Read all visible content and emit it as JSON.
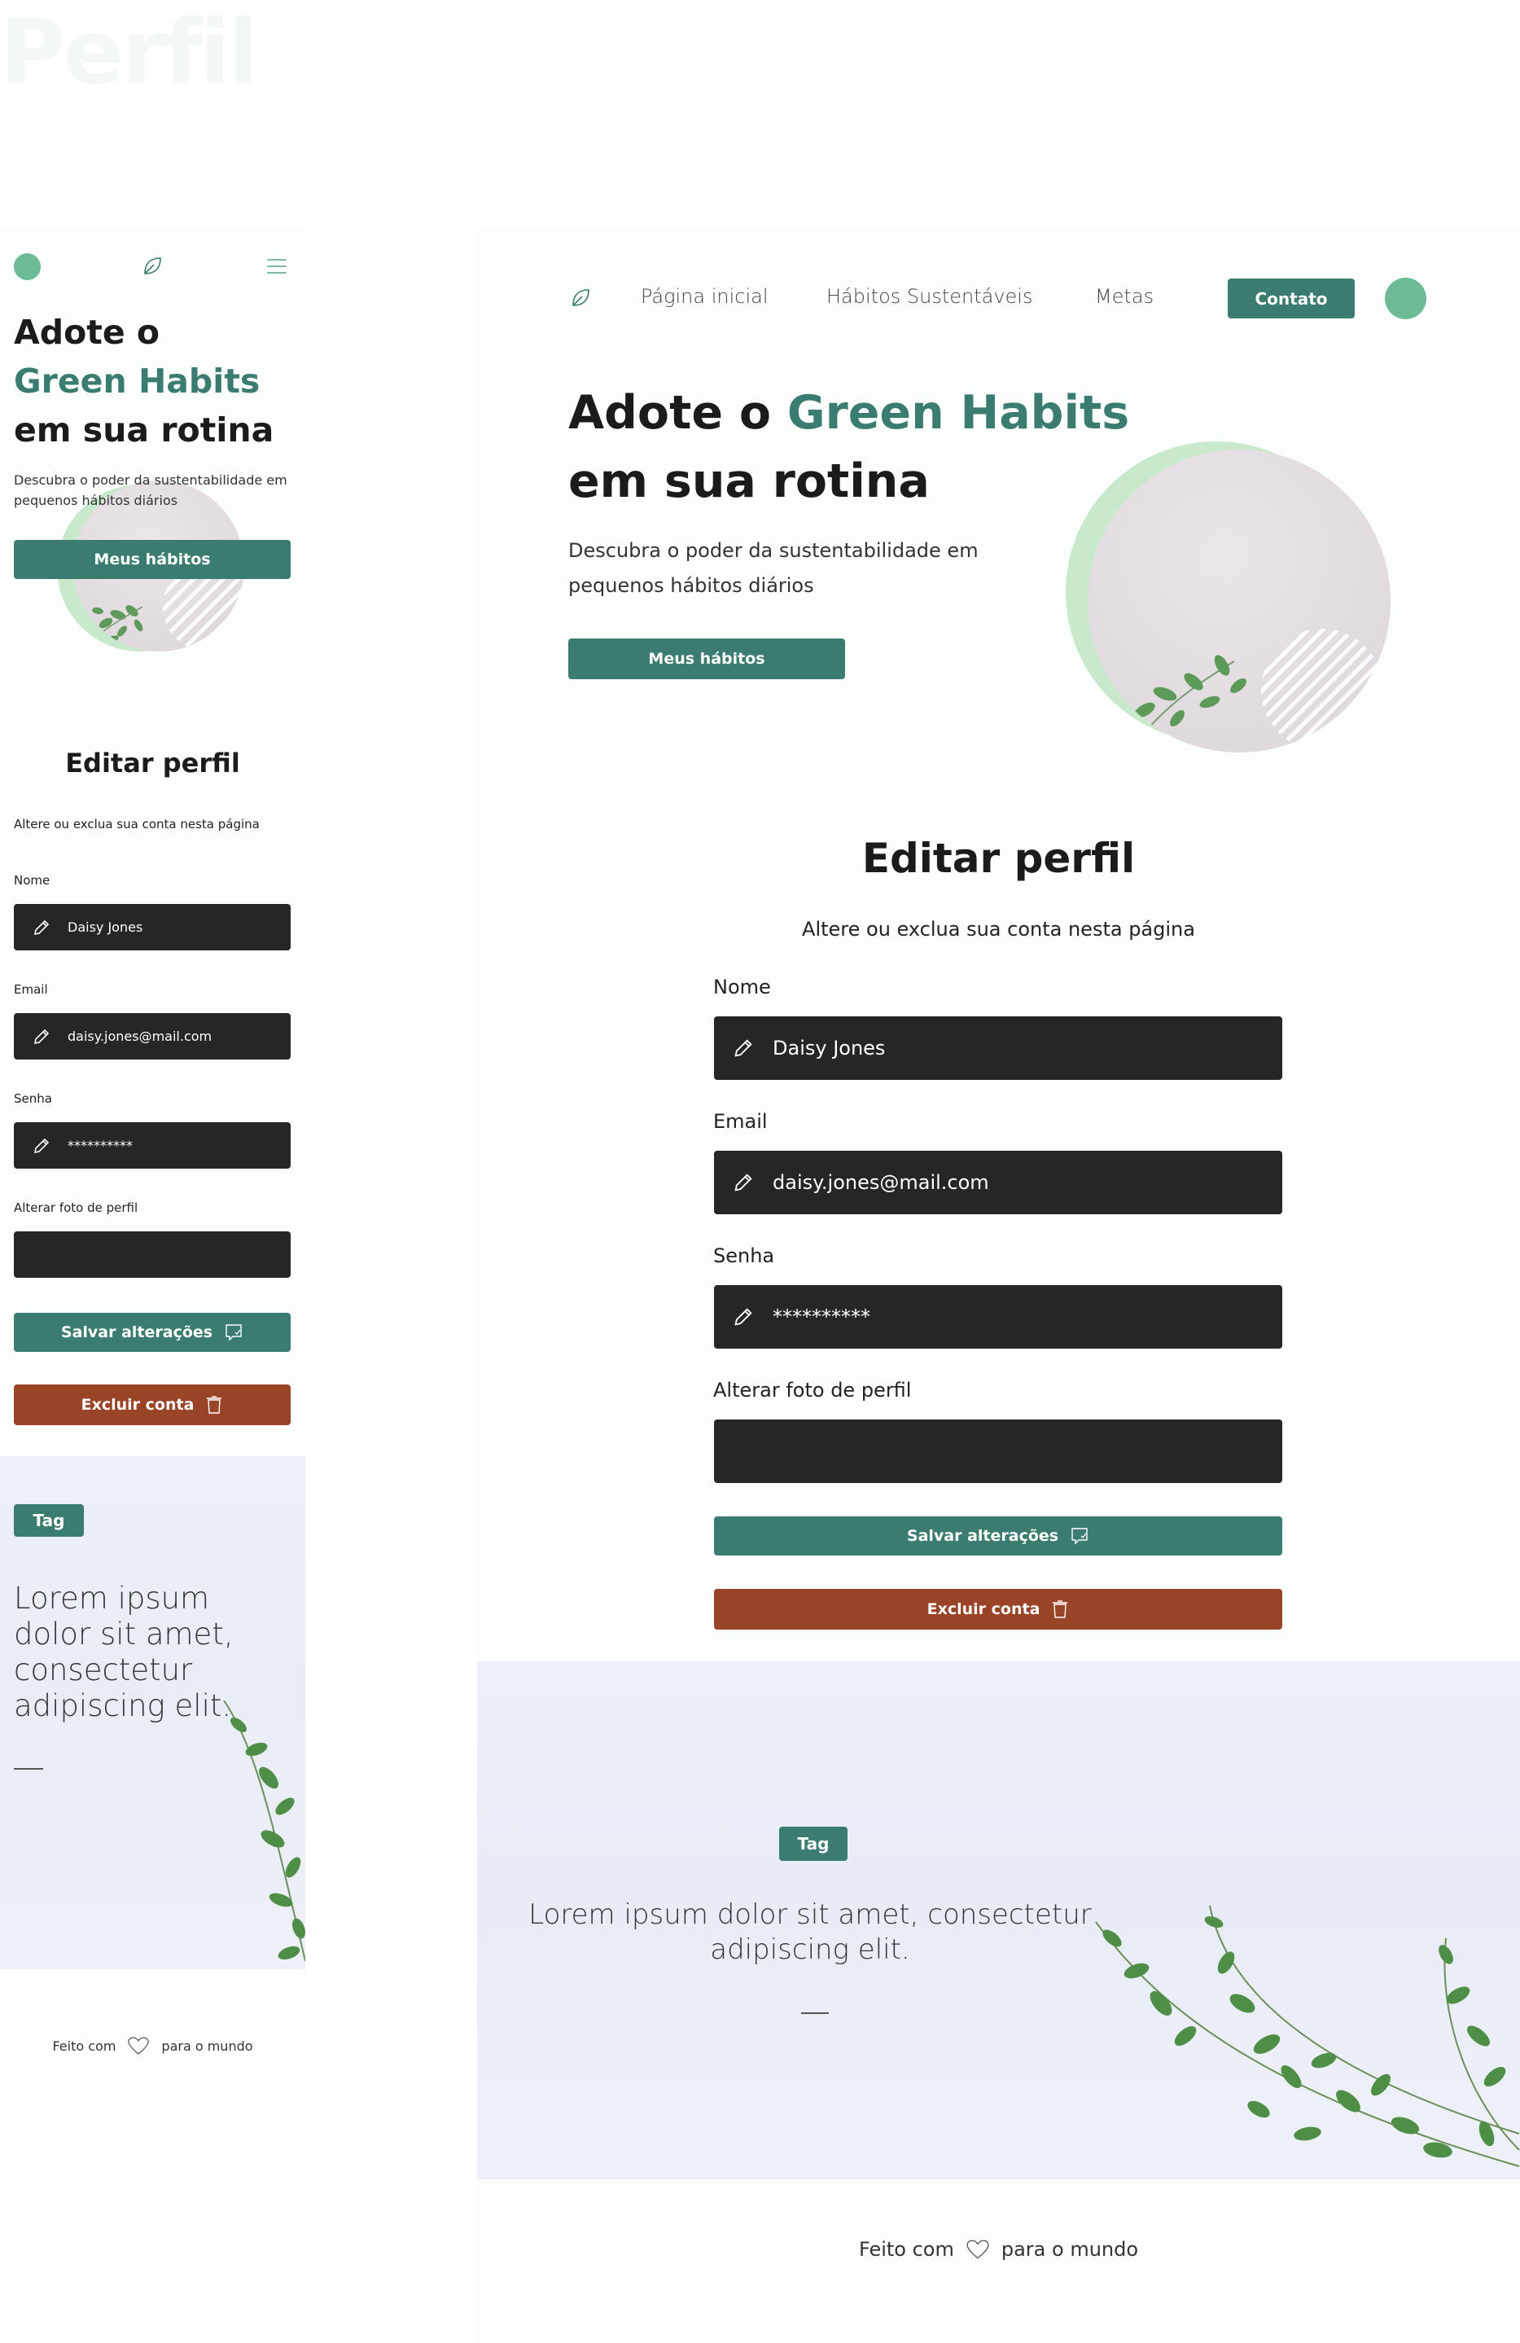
{
  "ghost_title": "Perfil",
  "hero": {
    "title_prefix": "Adote o",
    "title_brand": "Green Habits",
    "title_suffix": "em sua rotina",
    "subtitle": "Descubra o poder da sustentabilidade em pequenos hábitos diários",
    "button_label": "Meus hábitos"
  },
  "nav": {
    "items": [
      "Página inicial",
      "Hábitos Sustentáveis",
      "Metas"
    ],
    "contact_label": "Contato"
  },
  "edit_profile": {
    "title": "Editar perfil",
    "subtitle": "Altere ou exclua sua conta nesta página",
    "name_label": "Nome",
    "name_value": "Daisy Jones",
    "email_label": "Email",
    "email_value": "daisy.jones@mail.com",
    "password_label": "Senha",
    "password_value": "**********",
    "photo_label": "Alterar foto de perfil",
    "save_label": "Salvar alterações",
    "delete_label": "Excluir conta"
  },
  "banner": {
    "tag": "Tag",
    "quote": "Lorem ipsum dolor sit amet, consectetur adipiscing elit."
  },
  "footer": {
    "made_with": "Feito com",
    "for_world": "para o mundo"
  },
  "colors": {
    "primary_green": "#3a7d70",
    "accent_green": "#6dbb96",
    "danger": "#9a4427",
    "field_bg": "#252627"
  }
}
